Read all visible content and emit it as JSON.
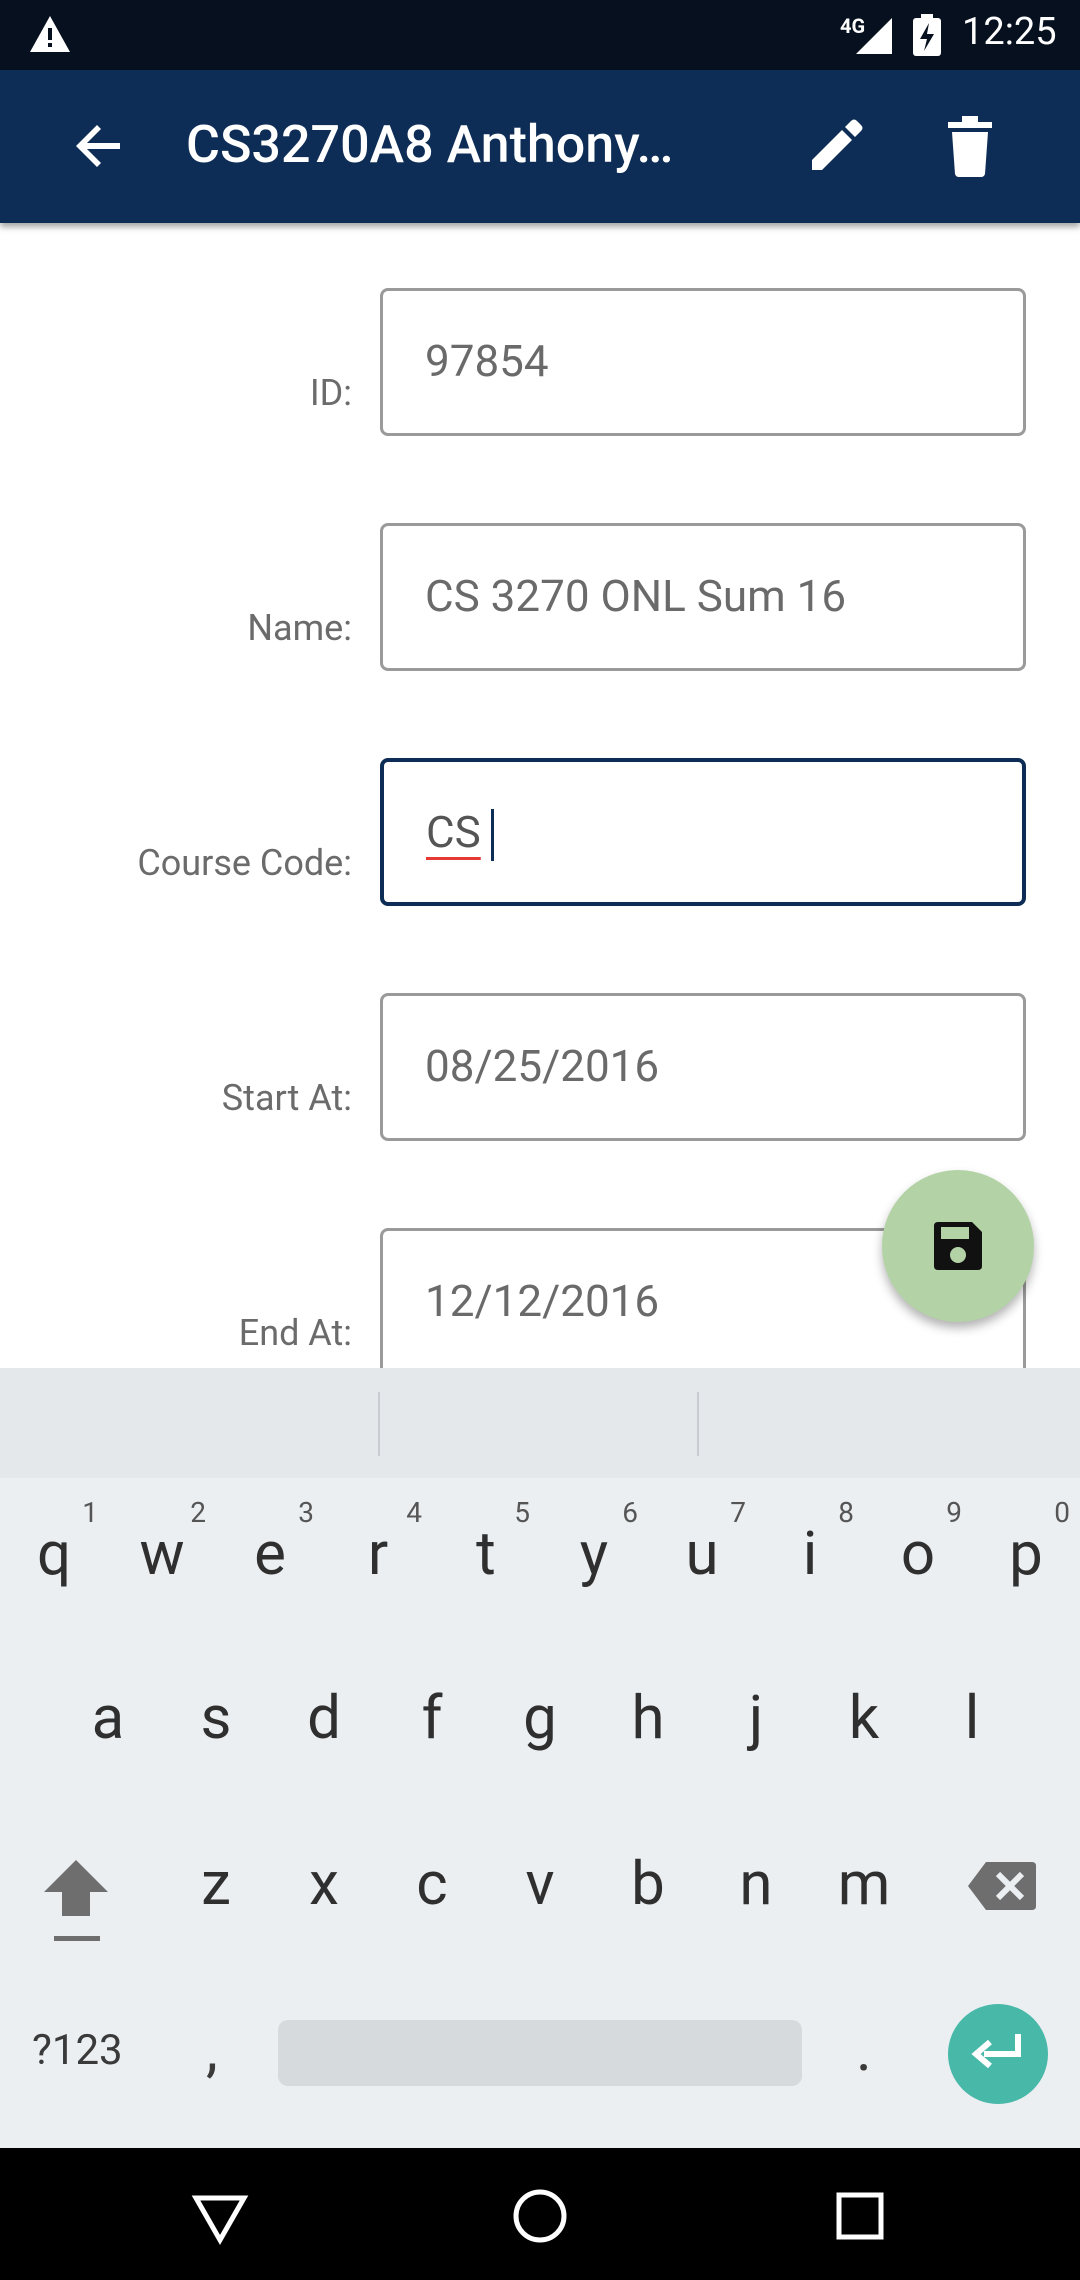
{
  "status": {
    "network": "4G",
    "time": "12:25"
  },
  "app_bar": {
    "title": "CS3270A8 Anthony…",
    "icons": {
      "back": "arrow-back-icon",
      "edit": "pencil-icon",
      "delete": "trash-icon"
    }
  },
  "form": {
    "fields": [
      {
        "label": "ID:",
        "value": "97854"
      },
      {
        "label": "Name:",
        "value": "CS 3270 ONL Sum 16"
      },
      {
        "label": "Course Code:",
        "value": "CS"
      },
      {
        "label": "Start At:",
        "value": "08/25/2016"
      },
      {
        "label": "End At:",
        "value": "12/12/2016"
      }
    ]
  },
  "fab": {
    "icon": "save-icon"
  },
  "keyboard": {
    "row1": [
      {
        "key": "q",
        "hint": "1"
      },
      {
        "key": "w",
        "hint": "2"
      },
      {
        "key": "e",
        "hint": "3"
      },
      {
        "key": "r",
        "hint": "4"
      },
      {
        "key": "t",
        "hint": "5"
      },
      {
        "key": "y",
        "hint": "6"
      },
      {
        "key": "u",
        "hint": "7"
      },
      {
        "key": "i",
        "hint": "8"
      },
      {
        "key": "o",
        "hint": "9"
      },
      {
        "key": "p",
        "hint": "0"
      }
    ],
    "row2": [
      "a",
      "s",
      "d",
      "f",
      "g",
      "h",
      "j",
      "k",
      "l"
    ],
    "row3": [
      "z",
      "x",
      "c",
      "v",
      "b",
      "n",
      "m"
    ],
    "symbols_label": "?123",
    "comma": ",",
    "period": "."
  },
  "colors": {
    "app_bar": "#0e2d56",
    "fab": "#b3d3a6",
    "enter_key": "#48b8a8"
  }
}
